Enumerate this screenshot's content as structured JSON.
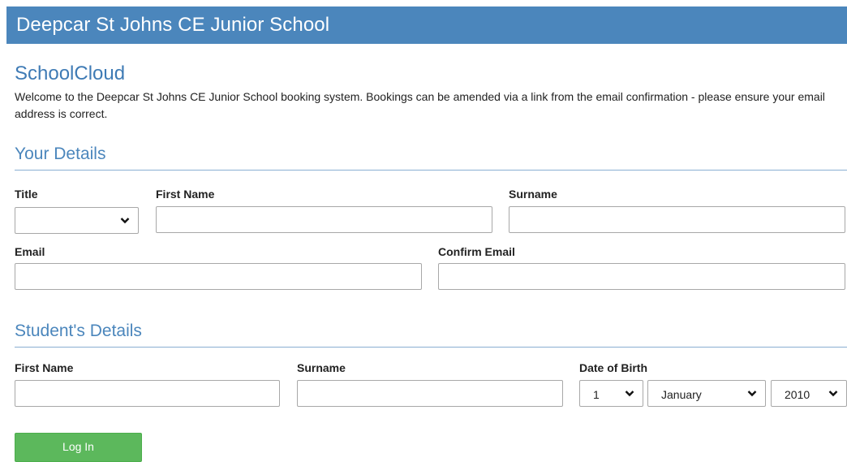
{
  "header": {
    "school_name": "Deepcar St Johns CE Junior School"
  },
  "brand": "SchoolCloud",
  "intro": "Welcome to the Deepcar St Johns CE Junior School booking system. Bookings can be amended via a link from the email confirmation - please ensure your email address is correct.",
  "your_details": {
    "heading": "Your Details",
    "title_label": "Title",
    "title_value": "",
    "first_name_label": "First Name",
    "first_name_value": "",
    "surname_label": "Surname",
    "surname_value": "",
    "email_label": "Email",
    "email_value": "",
    "confirm_email_label": "Confirm Email",
    "confirm_email_value": ""
  },
  "student_details": {
    "heading": "Student's Details",
    "first_name_label": "First Name",
    "first_name_value": "",
    "surname_label": "Surname",
    "surname_value": "",
    "dob_label": "Date of Birth",
    "dob_day": "1",
    "dob_month": "January",
    "dob_year": "2010"
  },
  "login_button": "Log In",
  "colors": {
    "header": "#4b86bc",
    "accent": "#3f7bb5",
    "button": "#5cb85c"
  },
  "icons": {
    "dropdown": "chevron-down-icon"
  }
}
